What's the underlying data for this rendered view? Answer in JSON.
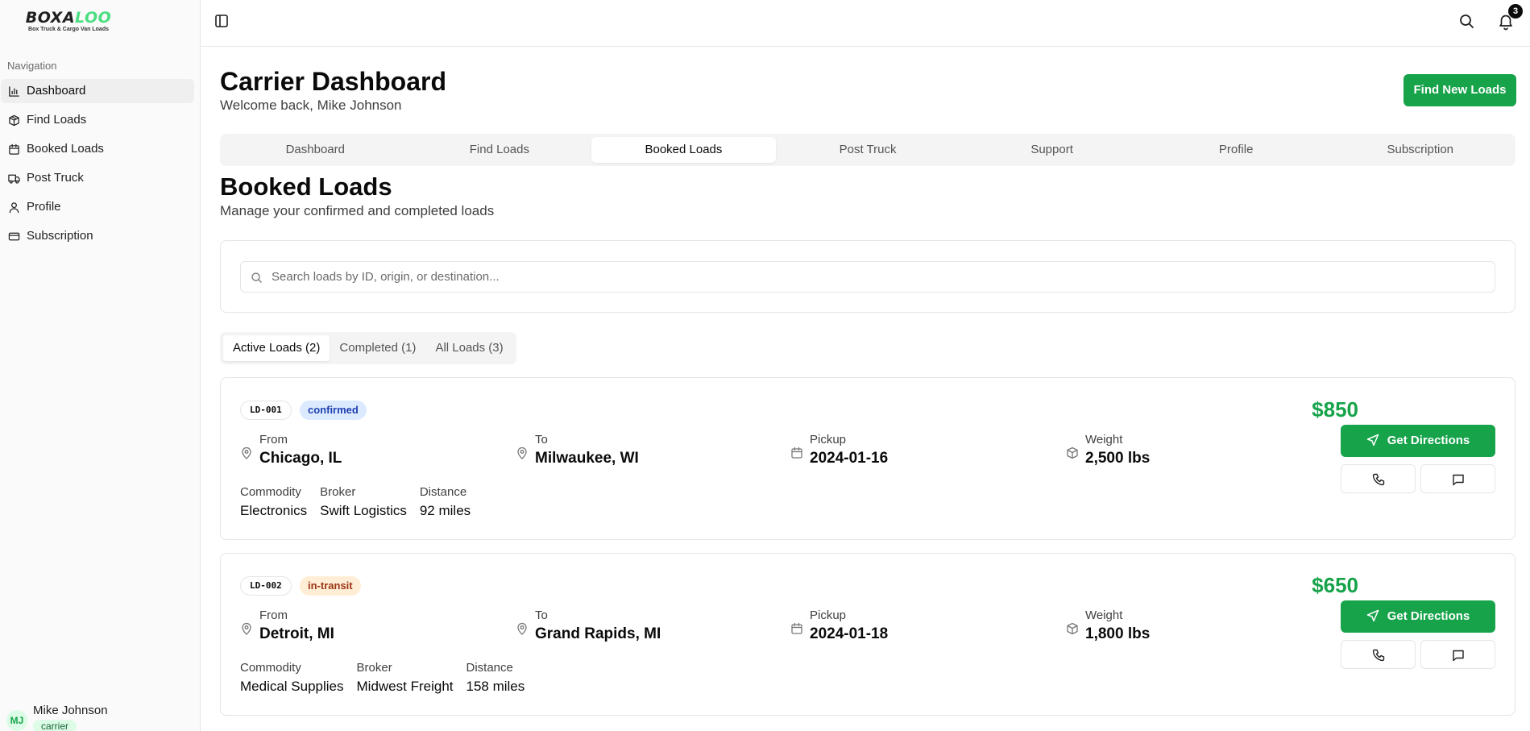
{
  "brand": {
    "logo_part1": "BOXA",
    "logo_part2": "LOO",
    "tagline": "Box Truck & Cargo Van Loads"
  },
  "sidebar": {
    "heading": "Navigation",
    "items": [
      {
        "label": "Dashboard",
        "icon": "bar-chart-icon",
        "active": true
      },
      {
        "label": "Find Loads",
        "icon": "package-icon"
      },
      {
        "label": "Booked Loads",
        "icon": "calendar-icon"
      },
      {
        "label": "Post Truck",
        "icon": "truck-icon"
      },
      {
        "label": "Profile",
        "icon": "user-icon"
      },
      {
        "label": "Subscription",
        "icon": "credit-card-icon"
      }
    ]
  },
  "user": {
    "initials": "MJ",
    "name": "Mike Johnson",
    "role": "carrier"
  },
  "topbar": {
    "notification_count": "3",
    "icons": [
      "sidebar-toggle-icon",
      "search-icon",
      "bell-icon"
    ]
  },
  "header": {
    "title": "Carrier Dashboard",
    "subtitle": "Welcome back, Mike Johnson",
    "find_loads_button": "Find New Loads"
  },
  "main_tabs": [
    {
      "label": "Dashboard"
    },
    {
      "label": "Find Loads"
    },
    {
      "label": "Booked Loads",
      "active": true
    },
    {
      "label": "Post Truck"
    },
    {
      "label": "Support"
    },
    {
      "label": "Profile"
    },
    {
      "label": "Subscription"
    }
  ],
  "section": {
    "title": "Booked Loads",
    "subtitle": "Manage your confirmed and completed loads"
  },
  "search": {
    "placeholder": "Search loads by ID, origin, or destination...",
    "value": ""
  },
  "sub_tabs": [
    {
      "label": "Active Loads (2)",
      "active": true
    },
    {
      "label": "Completed (1)"
    },
    {
      "label": "All Loads (3)"
    }
  ],
  "field_labels": {
    "from": "From",
    "to": "To",
    "pickup": "Pickup",
    "weight": "Weight",
    "commodity": "Commodity",
    "broker": "Broker",
    "distance": "Distance",
    "directions_button": "Get Directions"
  },
  "loads": [
    {
      "id": "LD-001",
      "status": "confirmed",
      "status_color": "#1e40af",
      "price": "$850",
      "from": "Chicago, IL",
      "to": "Milwaukee, WI",
      "pickup": "2024-01-16",
      "weight": "2,500 lbs",
      "commodity": "Electronics",
      "broker": "Swift Logistics",
      "distance": "92 miles"
    },
    {
      "id": "LD-002",
      "status": "in-transit",
      "status_color": "#9a3412",
      "price": "$650",
      "from": "Detroit, MI",
      "to": "Grand Rapids, MI",
      "pickup": "2024-01-18",
      "weight": "1,800 lbs",
      "commodity": "Medical Supplies",
      "broker": "Midwest Freight",
      "distance": "158 miles"
    }
  ],
  "colors": {
    "accent_green": "#16a34a",
    "confirmed_badge_bg": "#dbeafe",
    "in_transit_badge_bg": "#ffedd5"
  }
}
